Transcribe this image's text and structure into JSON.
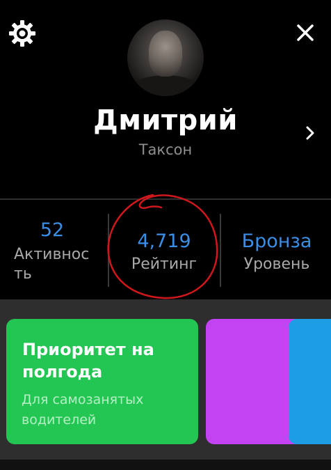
{
  "profile": {
    "name": "Дмитрий",
    "subtitle": "Таксон"
  },
  "icons": {
    "settings": "gear-icon",
    "close": "close-icon",
    "open_profile": "chevron-right-icon"
  },
  "stats": [
    {
      "value": "52",
      "label": "Активность"
    },
    {
      "value": "4,719",
      "label": "Рейтинг"
    },
    {
      "value": "Бронза",
      "label": "Уровень"
    }
  ],
  "cards": [
    {
      "title": "Приоритет на полгода",
      "description": "Для самозанятых водителей",
      "color": "#23c553"
    },
    {
      "color": "#c343f3"
    },
    {
      "color": "#1d9de3"
    }
  ],
  "colors": {
    "accent": "#3a8ee6",
    "annotation": "#d0181c"
  }
}
